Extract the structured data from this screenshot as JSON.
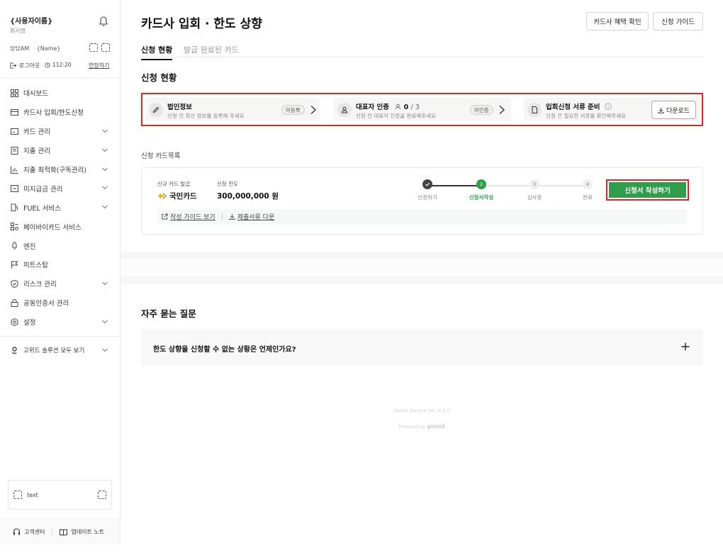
{
  "sidebar": {
    "user_name": "{사용자이름}",
    "company": "회사명",
    "am_label": "담당AM",
    "am_name": "{Name}",
    "logout": "로그아웃",
    "timer": "112:20",
    "extend": "연장하기",
    "nav": [
      {
        "label": "대시보드",
        "icon": "grid-icon",
        "chevron": false
      },
      {
        "label": "카드사 입회/한도신청",
        "icon": "card-icon",
        "chevron": false
      },
      {
        "label": "카드 관리",
        "icon": "card-manage-icon",
        "chevron": true
      },
      {
        "label": "지출 관리",
        "icon": "receipt-icon",
        "chevron": true
      },
      {
        "label": "지출 최적화(구독관리)",
        "icon": "chart-icon",
        "chevron": true
      },
      {
        "label": "미지급금 관리",
        "icon": "calendar-icon",
        "chevron": true
      },
      {
        "label": "FUEL 서비스",
        "icon": "fuel-icon",
        "chevron": true
      },
      {
        "label": "페이바이카드 서비스",
        "icon": "pay-icon",
        "chevron": false
      },
      {
        "label": "엔진",
        "icon": "rocket-icon",
        "chevron": false
      },
      {
        "label": "피트스탑",
        "icon": "flag-icon",
        "chevron": false
      },
      {
        "label": "리스크 관리",
        "icon": "shield-icon",
        "chevron": true
      },
      {
        "label": "공동인증서 관리",
        "icon": "lock-icon",
        "chevron": false
      },
      {
        "label": "설정",
        "icon": "gear-icon",
        "chevron": true
      }
    ],
    "solutions": "고위드 솔루션 모두 보기",
    "widget_text": "text",
    "support": "고객센터",
    "updates": "업데이트 노트"
  },
  "header": {
    "title": "카드사 입회 · 한도 상향",
    "btn_benefits": "카드사 혜택 확인",
    "btn_guide": "신청 가이드",
    "tabs": [
      "신청 현황",
      "발급 완료된 카드"
    ]
  },
  "status": {
    "section_title": "신청 현황",
    "steps": [
      {
        "title": "법인정보",
        "desc": "신청 전 최신 정보를 등록해 주세요",
        "badge": "미등록"
      },
      {
        "title": "대표자 인증",
        "count": "0",
        "total": "/ 3",
        "desc": "신청 전 대표자 인증을 완료해주세요",
        "badge": "미인증"
      },
      {
        "title": "입회신청 서류 준비",
        "desc": "신청 전 필요한 서류를 확인해주세요",
        "button": "다운로드"
      }
    ]
  },
  "card_list": {
    "title": "신청 카드목록",
    "new_card_label": "신규 카드 발급",
    "bank": "국민카드",
    "limit_label": "신청 한도",
    "limit_value": "300,000,000 원",
    "progress": {
      "current_step": 2,
      "steps": [
        {
          "num": "",
          "label": "신청하기"
        },
        {
          "num": "2",
          "label": "신청서작성"
        },
        {
          "num": "3",
          "label": "심사중"
        },
        {
          "num": "4",
          "label": "완료"
        }
      ]
    },
    "apply_btn": "신청서 작성하기",
    "guide_link": "작성 가이드 보기",
    "docs_link": "제출서류 다운"
  },
  "faq": {
    "title": "자주 묻는 질문",
    "items": [
      {
        "q": "한도 상향을 신청할 수 없는 상황은 언제인가요?"
      }
    ]
  },
  "footer": {
    "version": "Gowid Service Ver. 2.0.0",
    "powered": "Powered by",
    "brand": "gowid"
  },
  "colors": {
    "accent_green": "#2f9d4b",
    "highlight_red": "#d9262c",
    "kb_yellow": "#f5b400"
  }
}
